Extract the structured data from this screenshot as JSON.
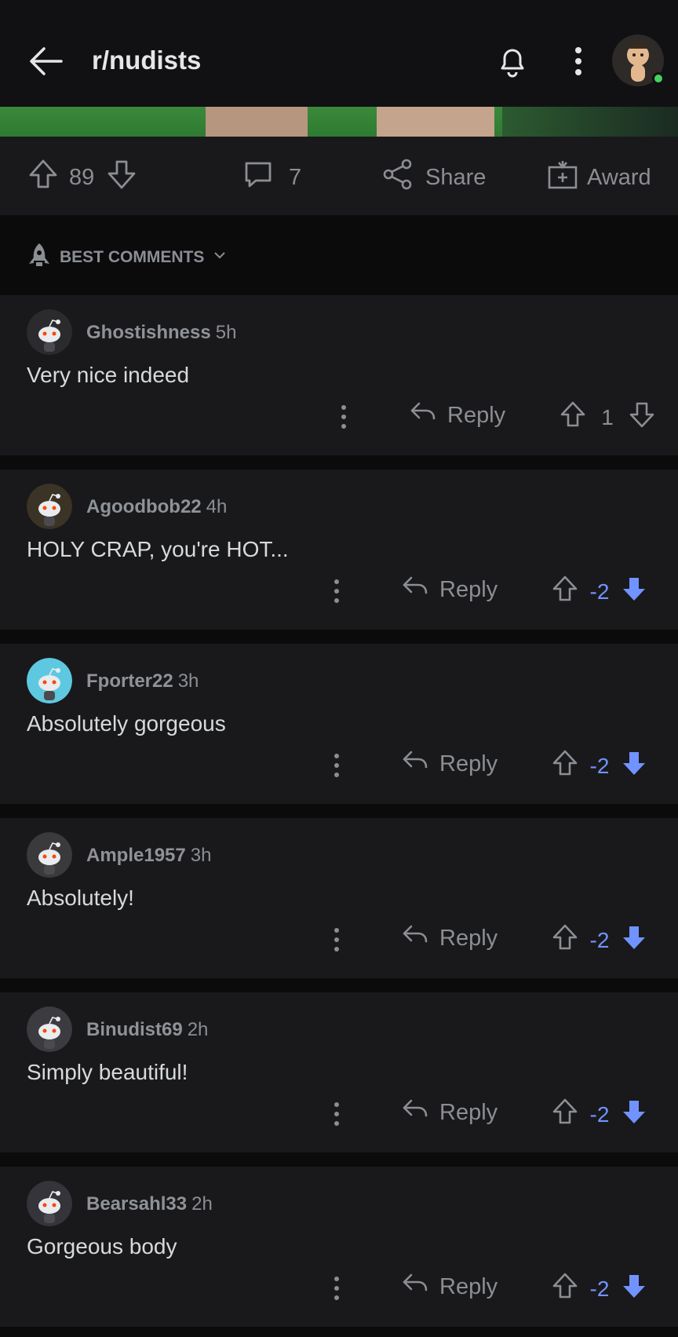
{
  "header": {
    "subreddit": "r/nudists",
    "icons": [
      "back-arrow-icon",
      "bell-icon",
      "more-vertical-icon",
      "avatar"
    ]
  },
  "post_actions": {
    "upvotes": "89",
    "comments": "7",
    "share_label": "Share",
    "award_label": "Award"
  },
  "sort": {
    "label": "BEST COMMENTS"
  },
  "comments": [
    {
      "user": "Ghostishness",
      "time": "5h",
      "body": "Very nice indeed",
      "reply_label": "Reply",
      "score": "1",
      "voted": "none"
    },
    {
      "user": "Agoodbob22",
      "time": "4h",
      "body": "HOLY CRAP, you're HOT...",
      "reply_label": "Reply",
      "score": "-2",
      "voted": "down"
    },
    {
      "user": "Fporter22",
      "time": "3h",
      "body": "Absolutely gorgeous",
      "reply_label": "Reply",
      "score": "-2",
      "voted": "down"
    },
    {
      "user": "Ample1957",
      "time": "3h",
      "body": "Absolutely!",
      "reply_label": "Reply",
      "score": "-2",
      "voted": "down"
    },
    {
      "user": "Binudist69",
      "time": "2h",
      "body": "Simply beautiful!",
      "reply_label": "Reply",
      "score": "-2",
      "voted": "down"
    },
    {
      "user": "Bearsahl33",
      "time": "2h",
      "body": "Gorgeous body",
      "reply_label": "Reply",
      "score": "-2",
      "voted": "down"
    }
  ],
  "colors": {
    "background": "#0b0b0c",
    "card": "#19191b",
    "downvote": "#7193ff",
    "muted": "#8b8e93",
    "online": "#46d160"
  }
}
